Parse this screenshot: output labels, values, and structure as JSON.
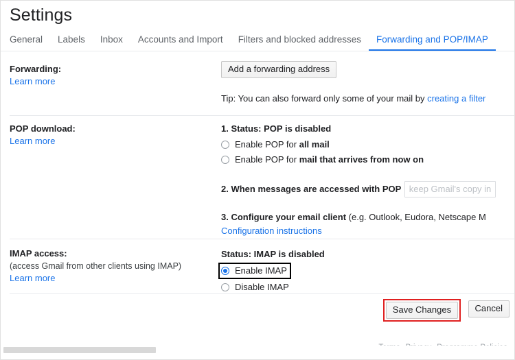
{
  "page": {
    "title": "Settings"
  },
  "tabs": [
    {
      "label": "General",
      "active": false
    },
    {
      "label": "Labels",
      "active": false
    },
    {
      "label": "Inbox",
      "active": false
    },
    {
      "label": "Accounts and Import",
      "active": false
    },
    {
      "label": "Filters and blocked addresses",
      "active": false
    },
    {
      "label": "Forwarding and POP/IMAP",
      "active": true
    }
  ],
  "forwarding": {
    "label": "Forwarding:",
    "learn_more": "Learn more",
    "add_address_button": "Add a forwarding address",
    "tip_prefix": "Tip: You can also forward only some of your mail by ",
    "tip_link": "creating a filter"
  },
  "pop": {
    "label": "POP download:",
    "learn_more": "Learn more",
    "step1_prefix": "1. Status: ",
    "step1_status": "POP is disabled",
    "option_all_prefix": "Enable POP for ",
    "option_all_bold": "all mail",
    "option_all_checked": false,
    "option_now_prefix": "Enable POP for ",
    "option_now_bold": "mail that arrives from now on",
    "option_now_checked": false,
    "step2_label": "2. When messages are accessed with POP",
    "step2_select_value": "keep Gmail's copy in",
    "step3_bold": "3. Configure your email client",
    "step3_rest": " (e.g. Outlook, Eudora, Netscape M",
    "step3_link": "Configuration instructions"
  },
  "imap": {
    "label": "IMAP access:",
    "sub_label": "(access Gmail from other clients using IMAP)",
    "learn_more": "Learn more",
    "status": "Status: IMAP is disabled",
    "enable_label": "Enable IMAP",
    "enable_checked": true,
    "enable_highlighted": true,
    "disable_label": "Disable IMAP",
    "disable_checked": false
  },
  "actions": {
    "save_label": "Save Changes",
    "save_highlighted": true,
    "cancel_label": "Cancel"
  },
  "footer": {
    "terms": "Terms",
    "privacy": "Privacy",
    "policies": "Programme Policies",
    "separator": "·"
  },
  "colors": {
    "accent_blue": "#1a73e8",
    "highlight_black": "#000000",
    "highlight_red": "#e02020",
    "text_primary": "#202124",
    "text_secondary": "#5f6368",
    "divider": "#e8eaed"
  }
}
